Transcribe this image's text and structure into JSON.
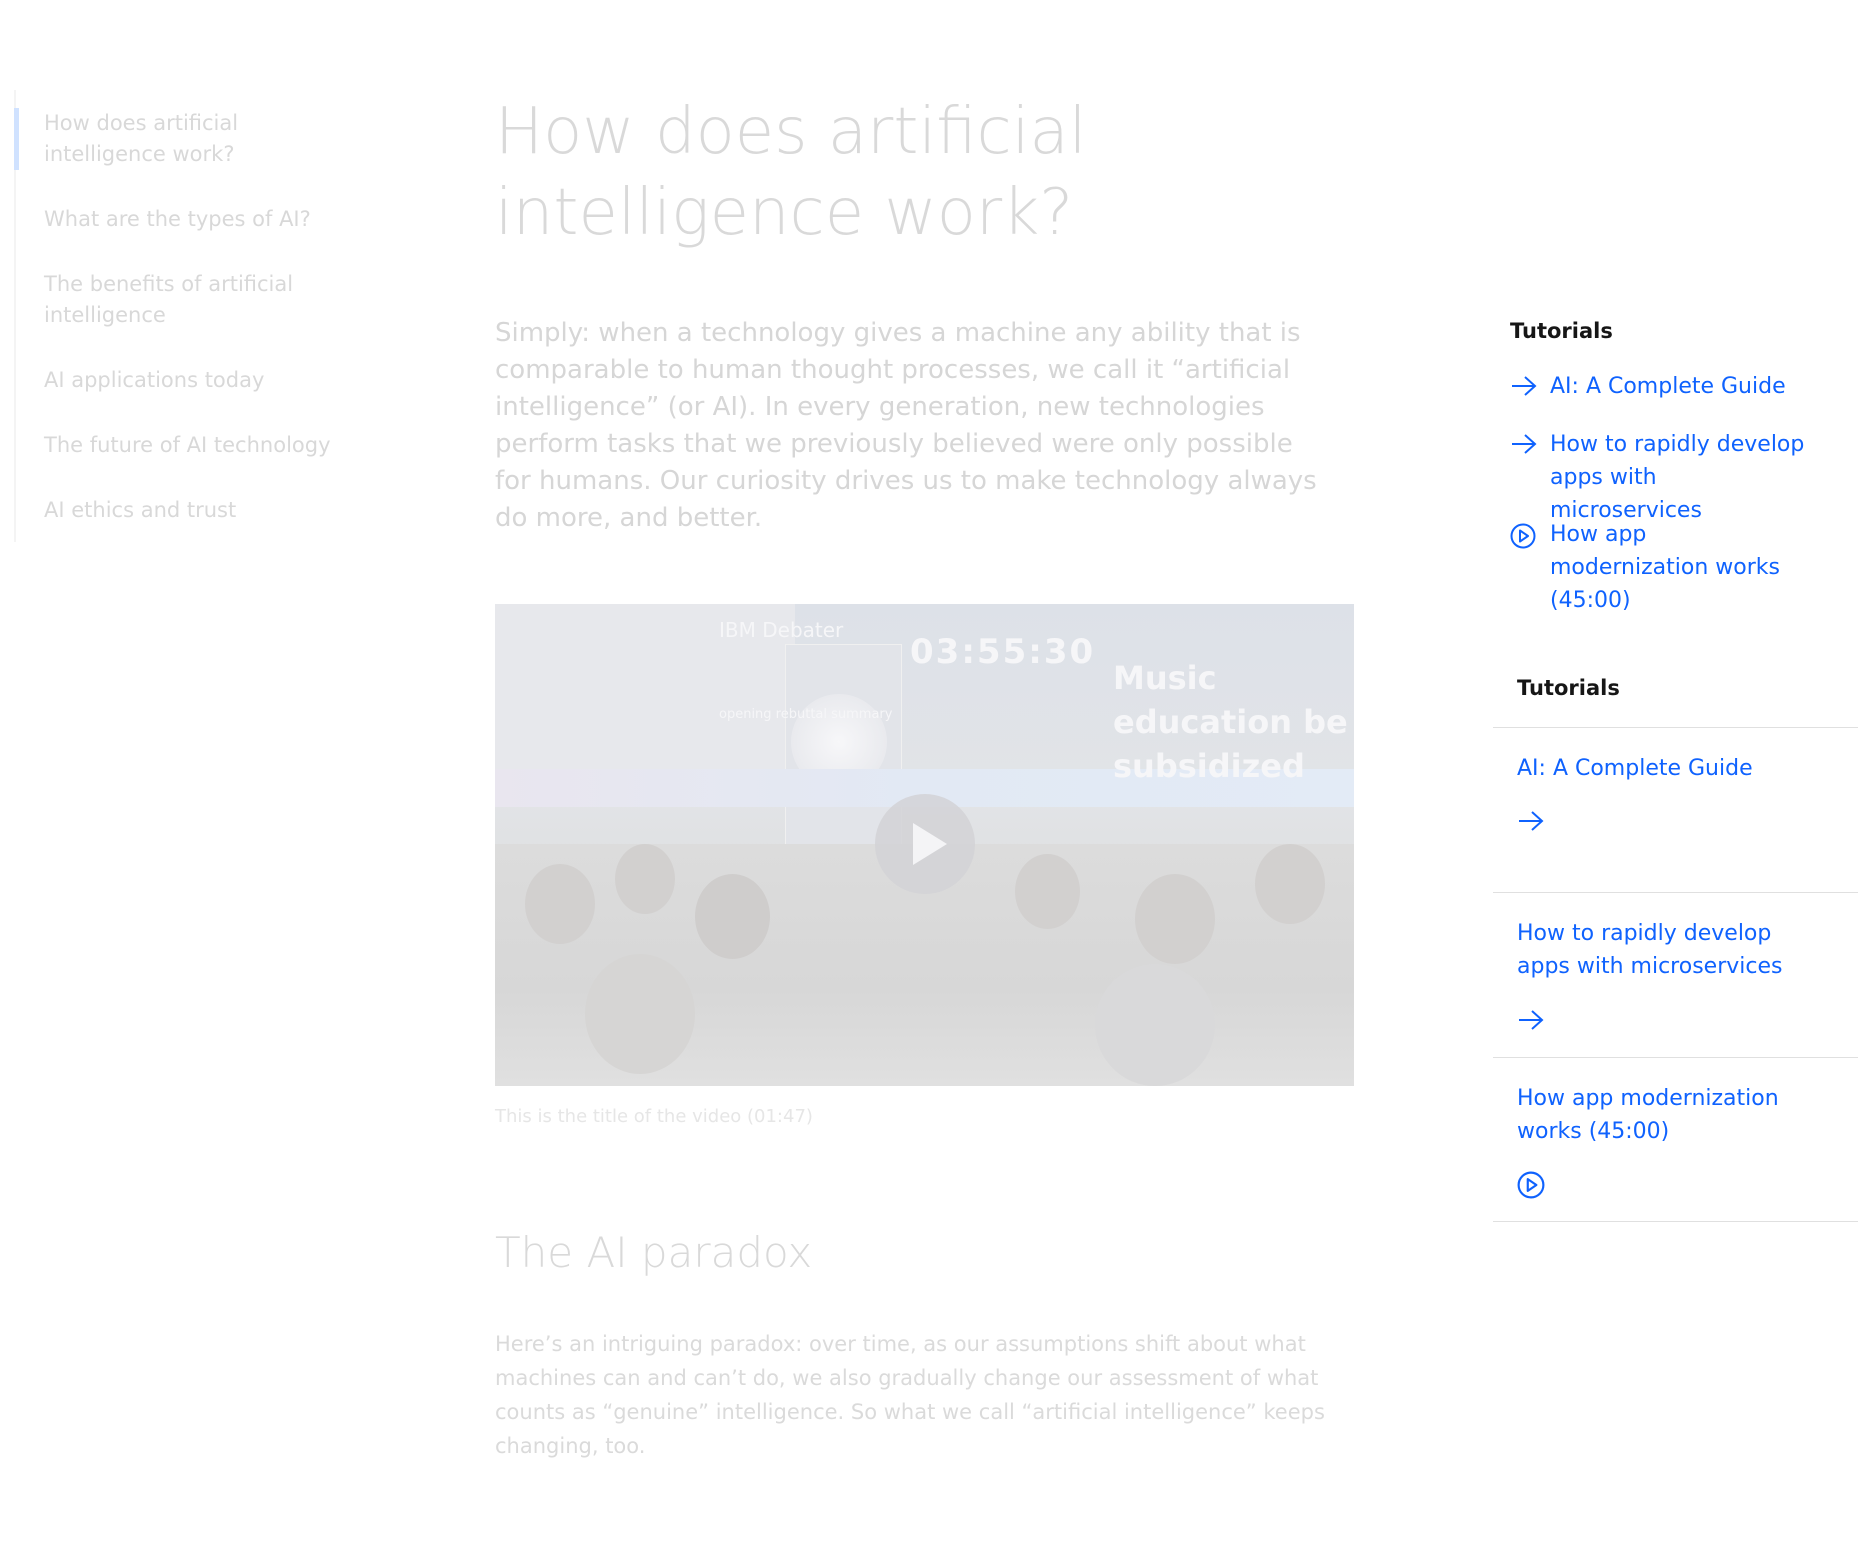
{
  "toc": {
    "items": [
      {
        "label": "How does artificial intelligence work?",
        "active": true
      },
      {
        "label": "What are the types of AI?"
      },
      {
        "label": "The benefits of artificial intelligence"
      },
      {
        "label": "AI applications today"
      },
      {
        "label": "The future of AI technology"
      },
      {
        "label": "AI ethics and trust"
      }
    ]
  },
  "article": {
    "title": "How does artificial intelligence work?",
    "lead": "Simply: when a technology gives a machine any ability that is comparable to human thought processes, we call it “artificial intelligence” (or AI). In every generation, new technologies perform tasks that we previously believed were only possible for humans. Our curiosity drives us to make technology always do more, and better.",
    "video": {
      "caption": "This is the title of the video (01:47)",
      "overlay_label": "IBM Debater",
      "overlay_timer": "03:55:30",
      "overlay_slide": "Music education be subsidized",
      "overlay_small": "opening rebuttal summary",
      "play_icon": "play-icon"
    },
    "section_title": "The AI paradox",
    "section_text": "Here’s an intriguing paradox: over time, as our assumptions shift about what machines can and can’t do, we also gradually change our assessment of what counts as “genuine” intelligence. So what we call “artificial intelligence” keeps changing, too."
  },
  "link_list": {
    "title": "Tutorials",
    "items": [
      {
        "label": "AI: A Complete Guide",
        "icon": "arrow-right-icon"
      },
      {
        "label": "How to rapidly develop apps with microservices",
        "icon": "arrow-right-icon"
      },
      {
        "label": "How app modernization works (45:00)",
        "icon": "play-circle-icon"
      }
    ]
  },
  "card_list": {
    "title": "Tutorials",
    "items": [
      {
        "label": "AI: A Complete Guide",
        "icon": "arrow-right-icon"
      },
      {
        "label": "How to rapidly develop apps with microservices",
        "icon": "arrow-right-icon"
      },
      {
        "label": "How app modernization works (45:00)",
        "icon": "play-circle-icon"
      }
    ]
  },
  "colors": {
    "link": "#0f62fe",
    "heading": "#161616",
    "faded_text": "#d6d6d6",
    "toc_active_bar": "#d0e2ff",
    "divider": "#e0e0e0"
  }
}
